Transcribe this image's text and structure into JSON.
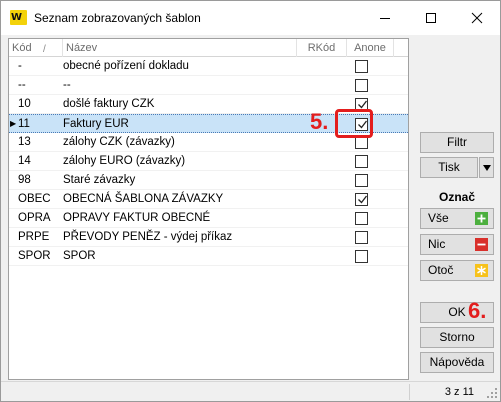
{
  "window": {
    "title": "Seznam zobrazovaných šablon",
    "app_icon_text": "W"
  },
  "table": {
    "columns": [
      "Kód",
      "Název",
      "RKód",
      "Anone"
    ],
    "sort_indicator": "/",
    "current_row_marker": "▶",
    "rows": [
      {
        "kod": "-",
        "nazev": "obecné pořízení dokladu",
        "rkod": "",
        "anone": false,
        "selected": false
      },
      {
        "kod": "--",
        "nazev": "--",
        "rkod": "",
        "anone": false,
        "selected": false
      },
      {
        "kod": "10",
        "nazev": "došlé faktury CZK",
        "rkod": "",
        "anone": true,
        "selected": false
      },
      {
        "kod": "11",
        "nazev": "Faktury EUR",
        "rkod": "",
        "anone": true,
        "selected": true
      },
      {
        "kod": "13",
        "nazev": "zálohy CZK (závazky)",
        "rkod": "",
        "anone": false,
        "selected": false
      },
      {
        "kod": "14",
        "nazev": "zálohy EURO (závazky)",
        "rkod": "",
        "anone": false,
        "selected": false
      },
      {
        "kod": "98",
        "nazev": "Staré závazky",
        "rkod": "",
        "anone": false,
        "selected": false
      },
      {
        "kod": "OBEC",
        "nazev": "OBECNÁ ŠABLONA ZÁVAZKY",
        "rkod": "",
        "anone": true,
        "selected": false
      },
      {
        "kod": "OPRA",
        "nazev": "OPRAVY FAKTUR OBECNÉ",
        "rkod": "",
        "anone": false,
        "selected": false
      },
      {
        "kod": "PRPE",
        "nazev": "PŘEVODY PENĚZ - výdej příkaz",
        "rkod": "",
        "anone": false,
        "selected": false
      },
      {
        "kod": "SPOR",
        "nazev": "SPOR",
        "rkod": "",
        "anone": false,
        "selected": false
      }
    ]
  },
  "annotations": {
    "step5": "5.",
    "step6": "6."
  },
  "side_panel": {
    "filtr": "Filtr",
    "tisk": "Tisk",
    "oznac": "Označ",
    "vse": "Vše",
    "nic": "Nic",
    "otoc": "Otoč",
    "ok": "OK",
    "storno": "Storno",
    "napoveda": "Nápověda"
  },
  "status": {
    "record_position": "3 z 11"
  },
  "colors": {
    "selection": "#c9e3f8",
    "annotation_red": "#e31d1d",
    "plus_green": "#4caf3e",
    "minus_red": "#d9302b",
    "star_yellow": "#f7c21b",
    "app_icon_yellow": "#f3d20a"
  }
}
